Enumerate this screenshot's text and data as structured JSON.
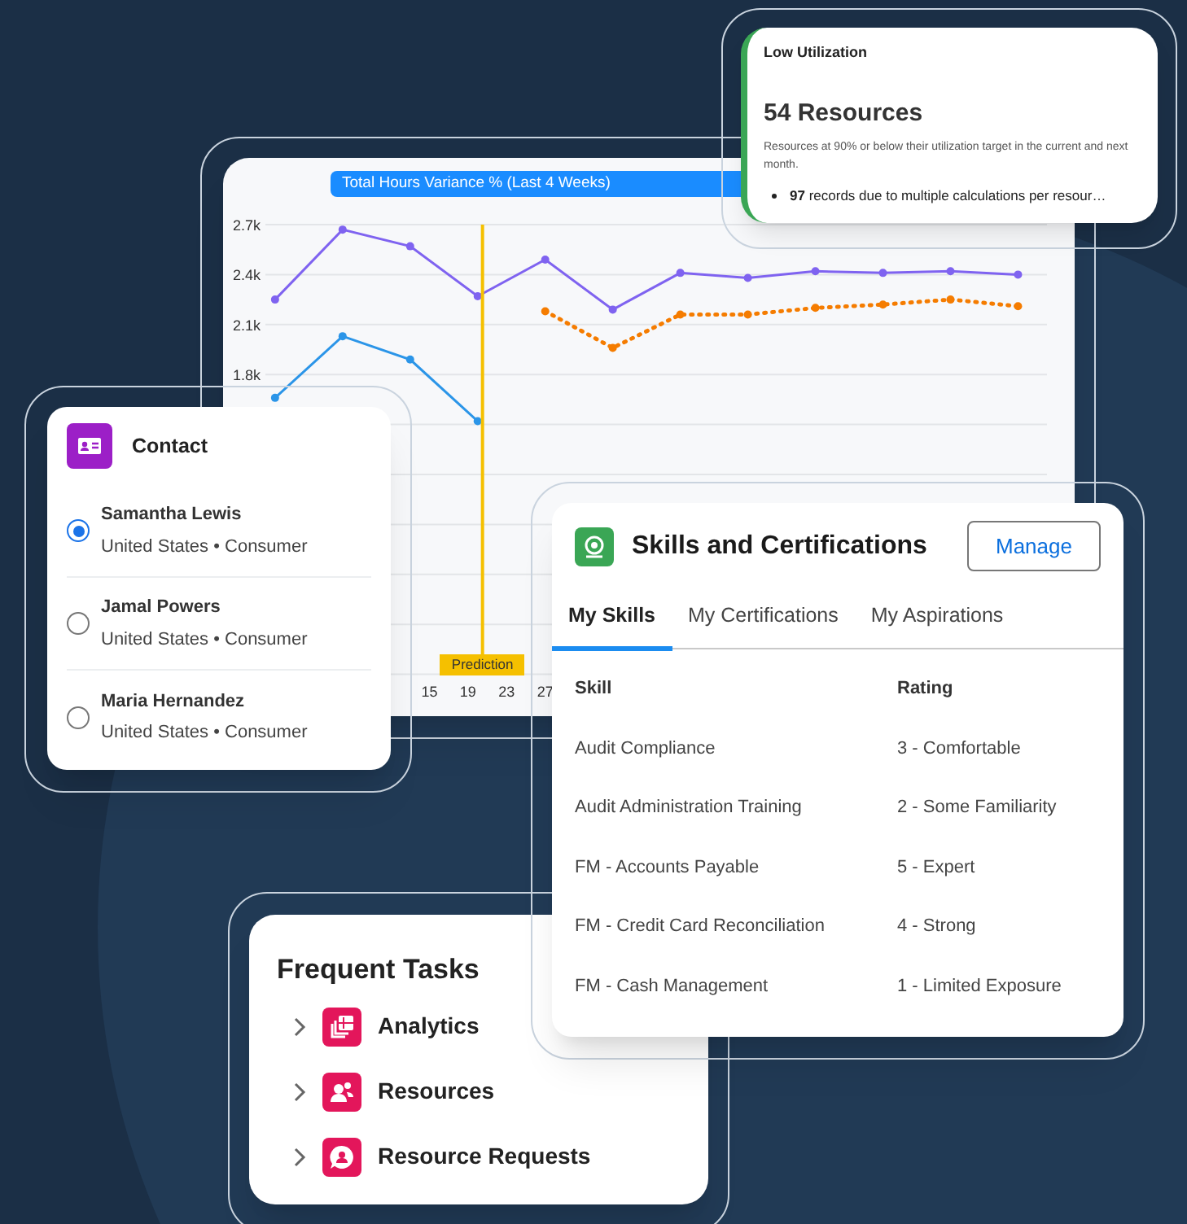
{
  "chart_card": {
    "chart_data": {
      "type": "line",
      "title": "Total Hours Variance % (Last 4 Weeks)",
      "x": [
        -1,
        6,
        13,
        20,
        27,
        34,
        41,
        48,
        55,
        62,
        69,
        76
      ],
      "xticks": [
        15,
        19,
        23,
        27
      ],
      "xlim": [
        -2,
        79
      ],
      "ylim": [
        0,
        2700
      ],
      "grid": true,
      "yticks": [
        {
          "value": 1800,
          "label": "1.8k"
        },
        {
          "value": 2100,
          "label": "2.1k"
        },
        {
          "value": 2400,
          "label": "2.4k"
        },
        {
          "value": 2700,
          "label": "2.7k"
        }
      ],
      "series": [
        {
          "color": "#7f63f0",
          "marker": "circle",
          "line_style": "solid",
          "values": [
            2250,
            2670,
            2570,
            2270,
            2490,
            2190,
            2410,
            2380,
            2420,
            2410,
            2420,
            2400
          ]
        },
        {
          "color": "#2b95e8",
          "marker": "circle",
          "line_style": "solid",
          "values": [
            1660,
            2030,
            1890,
            1520,
            null,
            null,
            null,
            null,
            null,
            null,
            null,
            null
          ]
        },
        {
          "color": "#f57c00",
          "marker": "circle",
          "line_style": "dotted",
          "values": [
            null,
            null,
            null,
            null,
            2180,
            1960,
            2160,
            2160,
            2200,
            2220,
            2250,
            2210
          ]
        }
      ],
      "annotations": [
        {
          "x": 20.5,
          "text": "Prediction"
        }
      ]
    }
  },
  "low_utilization": {
    "title": "Low Utilization",
    "headline": "54 Resources",
    "description": "Resources at 90% or below their utilization target in the current and next month.",
    "bullet": "**97** records due to multiple calculations per resour…"
  },
  "contact": {
    "title": "Contact",
    "items": [
      {
        "name": "Samantha Lewis",
        "detail": "United States • Consumer",
        "selected": true
      },
      {
        "name": "Jamal Powers",
        "detail": "United States • Consumer",
        "selected": false
      },
      {
        "name": "Maria Hernandez",
        "detail": "United States • Consumer",
        "selected": false
      }
    ]
  },
  "frequent_tasks": {
    "title": "Frequent Tasks",
    "items": [
      {
        "label": "Analytics",
        "kind": "analytics"
      },
      {
        "label": "Resources",
        "kind": "resources"
      },
      {
        "label": "Resource Requests",
        "kind": "requests"
      }
    ]
  },
  "skills": {
    "title": "Skills and Certifications",
    "button": "Manage",
    "tabs": [
      {
        "label": "My Skills",
        "selected": true
      },
      {
        "label": "My Certifications",
        "selected": false
      },
      {
        "label": "My Aspirations",
        "selected": false
      }
    ],
    "columns": [
      "Skill",
      "Rating"
    ],
    "rows": [
      [
        "Audit Compliance",
        "3 - Comfortable"
      ],
      [
        "Audit Administration Training",
        "2 - Some Familiarity"
      ],
      [
        "FM - Accounts Payable",
        "5 - Expert"
      ],
      [
        "FM - Credit Card Reconciliation",
        "4 - Strong"
      ],
      [
        "FM - Cash Management",
        "1 - Limited Exposure"
      ]
    ]
  }
}
